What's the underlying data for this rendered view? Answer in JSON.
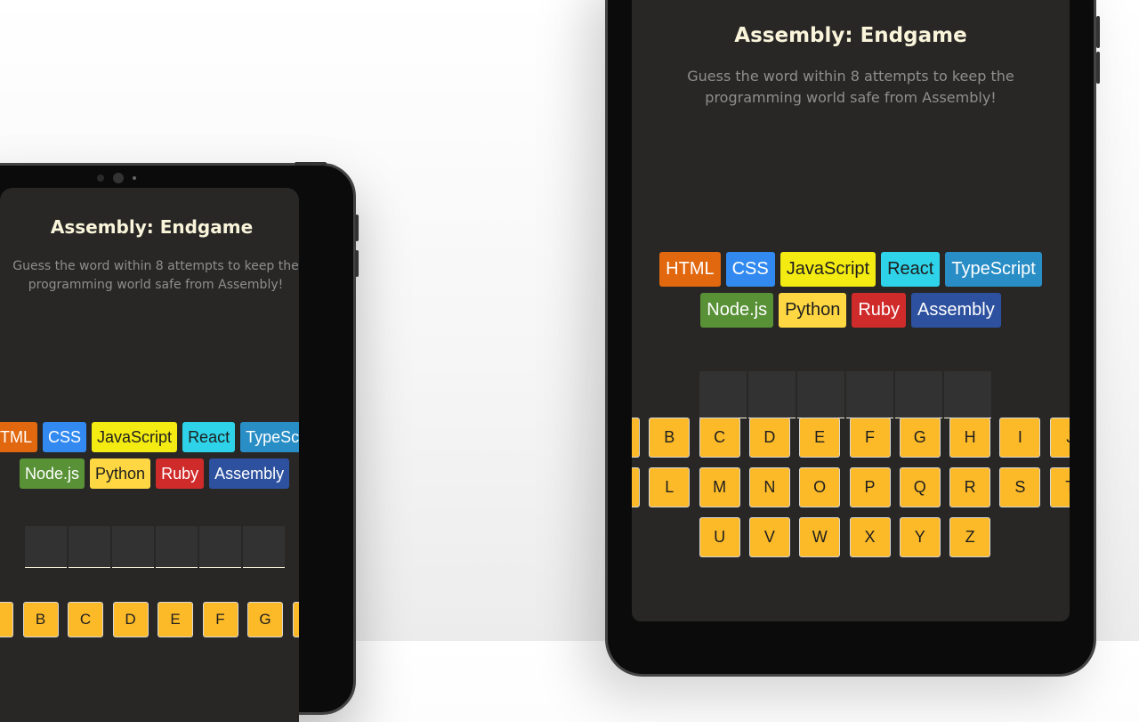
{
  "game": {
    "title": "Assembly: Endgame",
    "subtitle_line1": "Guess the word within 8 attempts to keep the",
    "subtitle_line2": "programming world safe from Assembly!",
    "languages": [
      {
        "name": "HTML",
        "bg": "#e2680f",
        "fg": "#ffffff"
      },
      {
        "name": "CSS",
        "bg": "#328af1",
        "fg": "#ffffff"
      },
      {
        "name": "JavaScript",
        "bg": "#f4eb13",
        "fg": "#1e1e1e"
      },
      {
        "name": "React",
        "bg": "#2ed3e9",
        "fg": "#1e1e1e"
      },
      {
        "name": "TypeScript",
        "bg": "#298ec6",
        "fg": "#ffffff"
      },
      {
        "name": "Node.js",
        "bg": "#599137",
        "fg": "#ffffff"
      },
      {
        "name": "Python",
        "bg": "#ffd742",
        "fg": "#1e1e1e"
      },
      {
        "name": "Ruby",
        "bg": "#d02b2b",
        "fg": "#ffffff"
      },
      {
        "name": "Assembly",
        "bg": "#2d519f",
        "fg": "#ffffff"
      }
    ],
    "word_slots": 6,
    "colors": {
      "screen_bg": "#282726",
      "title": "#f9f4da",
      "subtitle": "#8e8e8e",
      "key_bg": "#fcba29",
      "slot_bg": "#323232"
    }
  },
  "left_tablet": {
    "chip_row1_visible": [
      "HTML",
      "CSS",
      "JavaScript",
      "React",
      "TypeScript"
    ],
    "chip_row2_visible": [
      "Node.js",
      "Python",
      "Ruby",
      "Assembly"
    ],
    "keys_visible": [
      "",
      "B",
      "C",
      "D",
      "E",
      "F",
      "G",
      "H",
      ""
    ]
  },
  "right_tablet": {
    "keys_row1": [
      "",
      "B",
      "C",
      "D",
      "E",
      "F",
      "G",
      "H",
      "I",
      "J"
    ],
    "keys_row2": [
      "",
      "L",
      "M",
      "N",
      "O",
      "P",
      "Q",
      "R",
      "S",
      "T"
    ],
    "keys_row3": [
      "U",
      "V",
      "W",
      "X",
      "Y",
      "Z"
    ]
  }
}
